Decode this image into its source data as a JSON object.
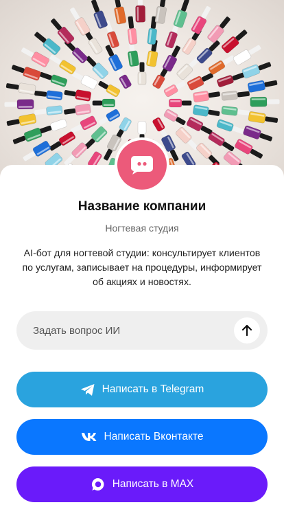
{
  "hero": {
    "alt": "nail polish bottles arranged in a circle"
  },
  "avatar": {
    "icon": "chat-bubble-icon",
    "color": "#ec5a7a"
  },
  "company": {
    "name": "Название компании",
    "subtitle": "Ногтевая студия",
    "description": "AI-бот для ногтевой студии: консультирует клиентов по услугам, записывает на процедуры, информирует об акциях и новостях."
  },
  "ask": {
    "placeholder": "Задать вопрос ИИ",
    "send_icon": "arrow-up-icon"
  },
  "buttons": {
    "telegram": {
      "label": "Написать в Telegram",
      "icon": "telegram-icon",
      "color": "#2aa3de"
    },
    "vk": {
      "label": "Написать Вконтакте",
      "icon": "vk-icon",
      "color": "#0a77ff"
    },
    "max": {
      "label": "Написать в MAX",
      "icon": "max-icon",
      "color": "#6a1bfa"
    }
  }
}
